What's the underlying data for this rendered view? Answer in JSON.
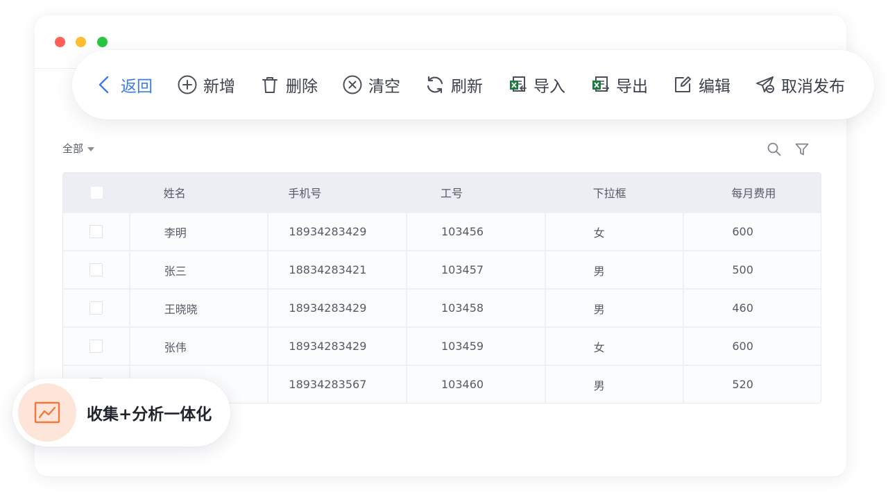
{
  "toolbar": {
    "back": "返回",
    "add": "新增",
    "delete": "删除",
    "clear": "清空",
    "refresh": "刷新",
    "import": "导入",
    "export": "导出",
    "edit": "编辑",
    "unpublish": "取消发布"
  },
  "filter": {
    "label": "全部"
  },
  "table": {
    "headers": [
      "姓名",
      "手机号",
      "工号",
      "下拉框",
      "每月费用"
    ],
    "rows": [
      [
        "李明",
        "18934283429",
        "103456",
        "女",
        "600"
      ],
      [
        "张三",
        "18834283421",
        "103457",
        "男",
        "500"
      ],
      [
        "王晓晓",
        "18934283429",
        "103458",
        "男",
        "460"
      ],
      [
        "张伟",
        "18934283429",
        "103459",
        "女",
        "600"
      ],
      [
        "",
        "18934283567",
        "103460",
        "男",
        "520"
      ]
    ]
  },
  "badge": {
    "text": "收集+分析一体化"
  },
  "colors": {
    "accent": "#3d7be6",
    "badge_icon": "#f07a3c",
    "excel_green": "#1f7a3e"
  },
  "icons": {
    "back": "chevron-left-icon",
    "add": "plus-circle-icon",
    "delete": "trash-icon",
    "clear": "x-circle-icon",
    "refresh": "refresh-icon",
    "import": "excel-import-icon",
    "export": "excel-export-icon",
    "edit": "edit-icon",
    "unpublish": "unpublish-icon",
    "search": "search-icon",
    "filter": "funnel-icon",
    "badge": "line-chart-icon"
  }
}
